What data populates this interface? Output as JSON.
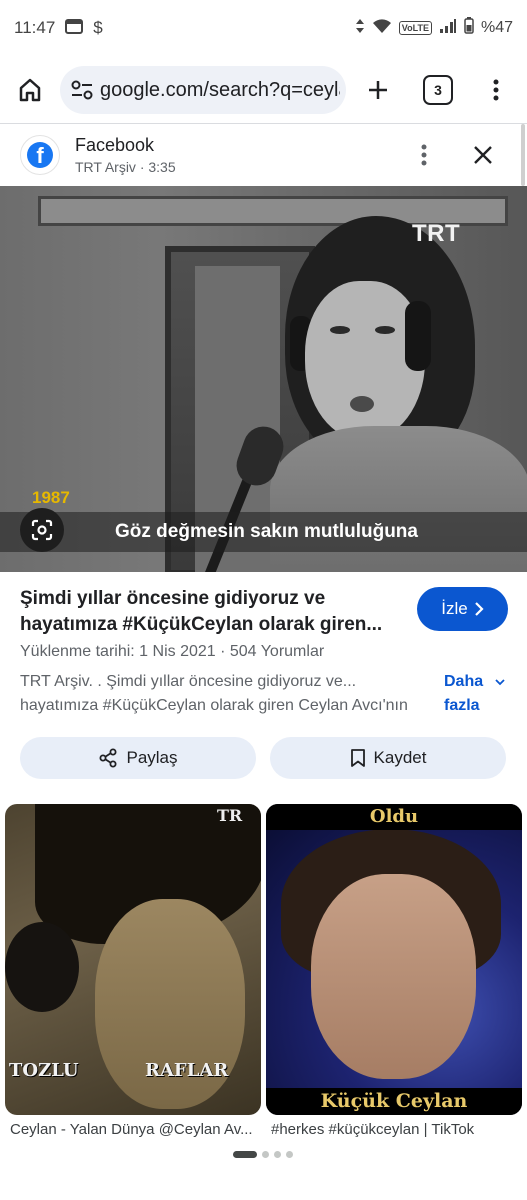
{
  "status": {
    "time": "11:47",
    "battery": "%47",
    "volte": "VoLTE"
  },
  "browser": {
    "url": "google.com/search?q=ceylan",
    "tab_count": "3",
    "icons": [
      "home-icon",
      "site-settings-icon",
      "plus-icon",
      "tabs-icon",
      "more-vert-icon"
    ]
  },
  "source": {
    "name": "Facebook",
    "subtitle": "TRT Arşiv · 3:35"
  },
  "video": {
    "watermark": "TRT",
    "year": "1987",
    "subtitle": "Göz değmesin sakın mutluluğuna"
  },
  "result": {
    "title": "Şimdi yıllar öncesine gidiyoruz ve hayatımıza #KüçükCeylan olarak giren...",
    "watch_label": "İzle",
    "meta": "Yüklenme tarihi: 1 Nis 2021  ·  504 Yorumlar",
    "description": "TRT Arşiv. . Şimdi yıllar öncesine gidiyoruz ve... hayatımıza #KüçükCeylan olarak giren Ceylan Avcı'nın",
    "more_label": "Daha fazla",
    "share_label": "Paylaş",
    "save_label": "Kaydet"
  },
  "related": [
    {
      "watermark": "TR",
      "overlay_left": "TOZLU",
      "overlay_right": "RAFLAR",
      "caption": "Ceylan - Yalan Dünya @Ceylan Av..."
    },
    {
      "overlay_top": "Oldu",
      "overlay_bottom": "Küçük Ceylan",
      "caption": "#herkes #küçükceylan | TikTok"
    }
  ],
  "pager": {
    "pages": 4,
    "active": 1
  },
  "colors": {
    "accent": "#0b57d0",
    "pill_bg": "#eef1f7",
    "action_bg": "#e8eef8",
    "facebook": "#1877f2",
    "year_label": "#e6b800"
  }
}
